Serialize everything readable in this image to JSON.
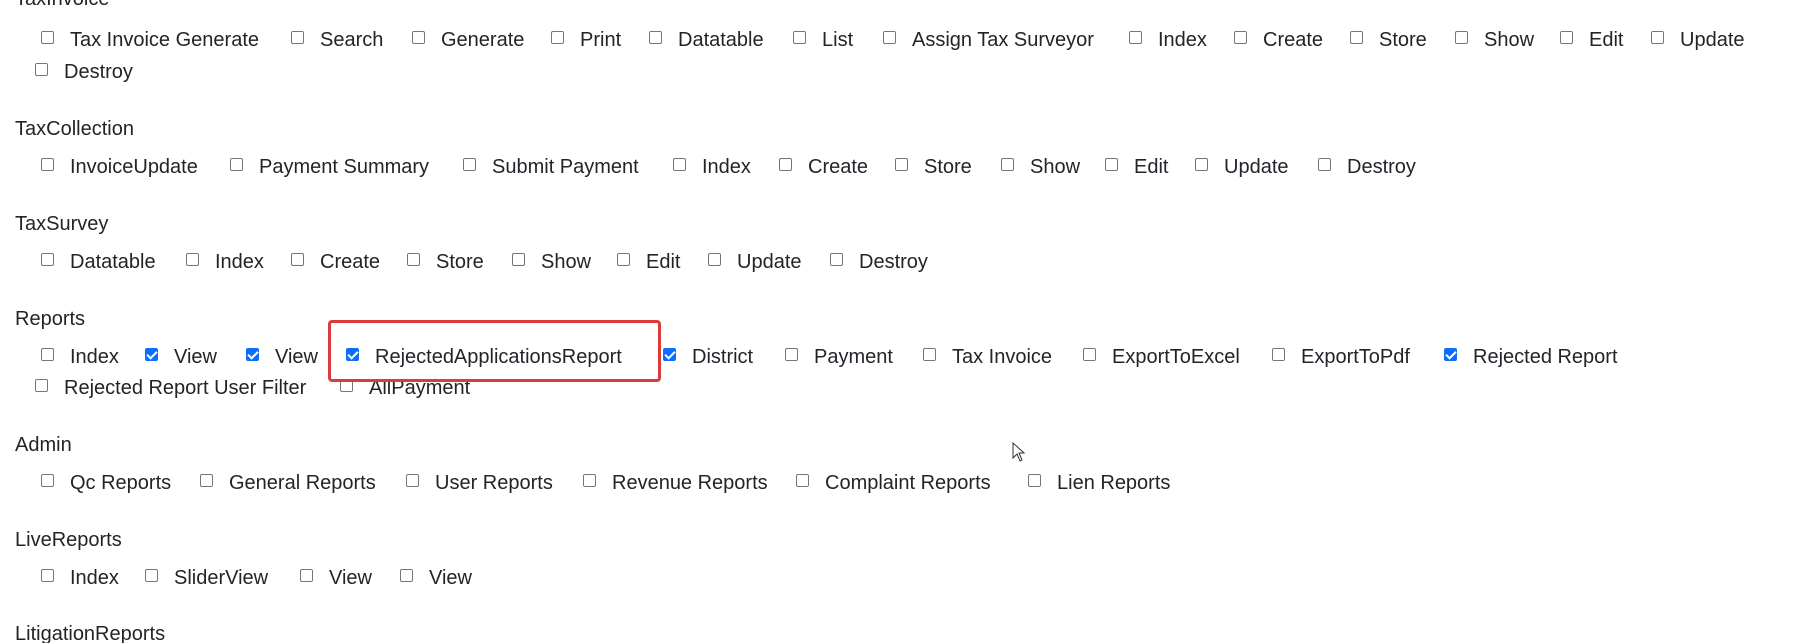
{
  "sections": [
    {
      "title": "TaxInvoice",
      "items": [
        {
          "label": "Tax Invoice Generate",
          "checked": false
        },
        {
          "label": "Search",
          "checked": false
        },
        {
          "label": "Generate",
          "checked": false
        },
        {
          "label": "Print",
          "checked": false
        },
        {
          "label": "Datatable",
          "checked": false
        },
        {
          "label": "List",
          "checked": false
        },
        {
          "label": "Assign Tax Surveyor",
          "checked": false
        },
        {
          "label": "Index",
          "checked": false
        },
        {
          "label": "Create",
          "checked": false
        },
        {
          "label": "Store",
          "checked": false
        },
        {
          "label": "Show",
          "checked": false
        },
        {
          "label": "Edit",
          "checked": false
        },
        {
          "label": "Update",
          "checked": false
        },
        {
          "label": "Destroy",
          "checked": false
        }
      ]
    },
    {
      "title": "TaxCollection",
      "items": [
        {
          "label": "InvoiceUpdate",
          "checked": false
        },
        {
          "label": "Payment Summary",
          "checked": false
        },
        {
          "label": "Submit Payment",
          "checked": false
        },
        {
          "label": "Index",
          "checked": false
        },
        {
          "label": "Create",
          "checked": false
        },
        {
          "label": "Store",
          "checked": false
        },
        {
          "label": "Show",
          "checked": false
        },
        {
          "label": "Edit",
          "checked": false
        },
        {
          "label": "Update",
          "checked": false
        },
        {
          "label": "Destroy",
          "checked": false
        }
      ]
    },
    {
      "title": "TaxSurvey",
      "items": [
        {
          "label": "Datatable",
          "checked": false
        },
        {
          "label": "Index",
          "checked": false
        },
        {
          "label": "Create",
          "checked": false
        },
        {
          "label": "Store",
          "checked": false
        },
        {
          "label": "Show",
          "checked": false
        },
        {
          "label": "Edit",
          "checked": false
        },
        {
          "label": "Update",
          "checked": false
        },
        {
          "label": "Destroy",
          "checked": false
        }
      ]
    },
    {
      "title": "Reports",
      "items": [
        {
          "label": "Index",
          "checked": false
        },
        {
          "label": "View",
          "checked": true
        },
        {
          "label": "View",
          "checked": true
        },
        {
          "label": "RejectedApplicationsReport",
          "checked": true
        },
        {
          "label": "District",
          "checked": true
        },
        {
          "label": "Payment",
          "checked": false
        },
        {
          "label": "Tax Invoice",
          "checked": false
        },
        {
          "label": "ExportToExcel",
          "checked": false
        },
        {
          "label": "ExportToPdf",
          "checked": false
        },
        {
          "label": "Rejected Report",
          "checked": true
        },
        {
          "label": "Rejected Report User Filter",
          "checked": false
        },
        {
          "label": "AllPayment",
          "checked": false
        }
      ]
    },
    {
      "title": "Admin",
      "items": [
        {
          "label": "Qc Reports",
          "checked": false
        },
        {
          "label": "General Reports",
          "checked": false
        },
        {
          "label": "User Reports",
          "checked": false
        },
        {
          "label": "Revenue Reports",
          "checked": false
        },
        {
          "label": "Complaint Reports",
          "checked": false
        },
        {
          "label": "Lien Reports",
          "checked": false
        }
      ]
    },
    {
      "title": "LiveReports",
      "items": [
        {
          "label": "Index",
          "checked": false
        },
        {
          "label": "SliderView",
          "checked": false
        },
        {
          "label": "View",
          "checked": false
        },
        {
          "label": "View",
          "checked": false
        }
      ]
    },
    {
      "title": "LitigationReports",
      "items": []
    }
  ]
}
